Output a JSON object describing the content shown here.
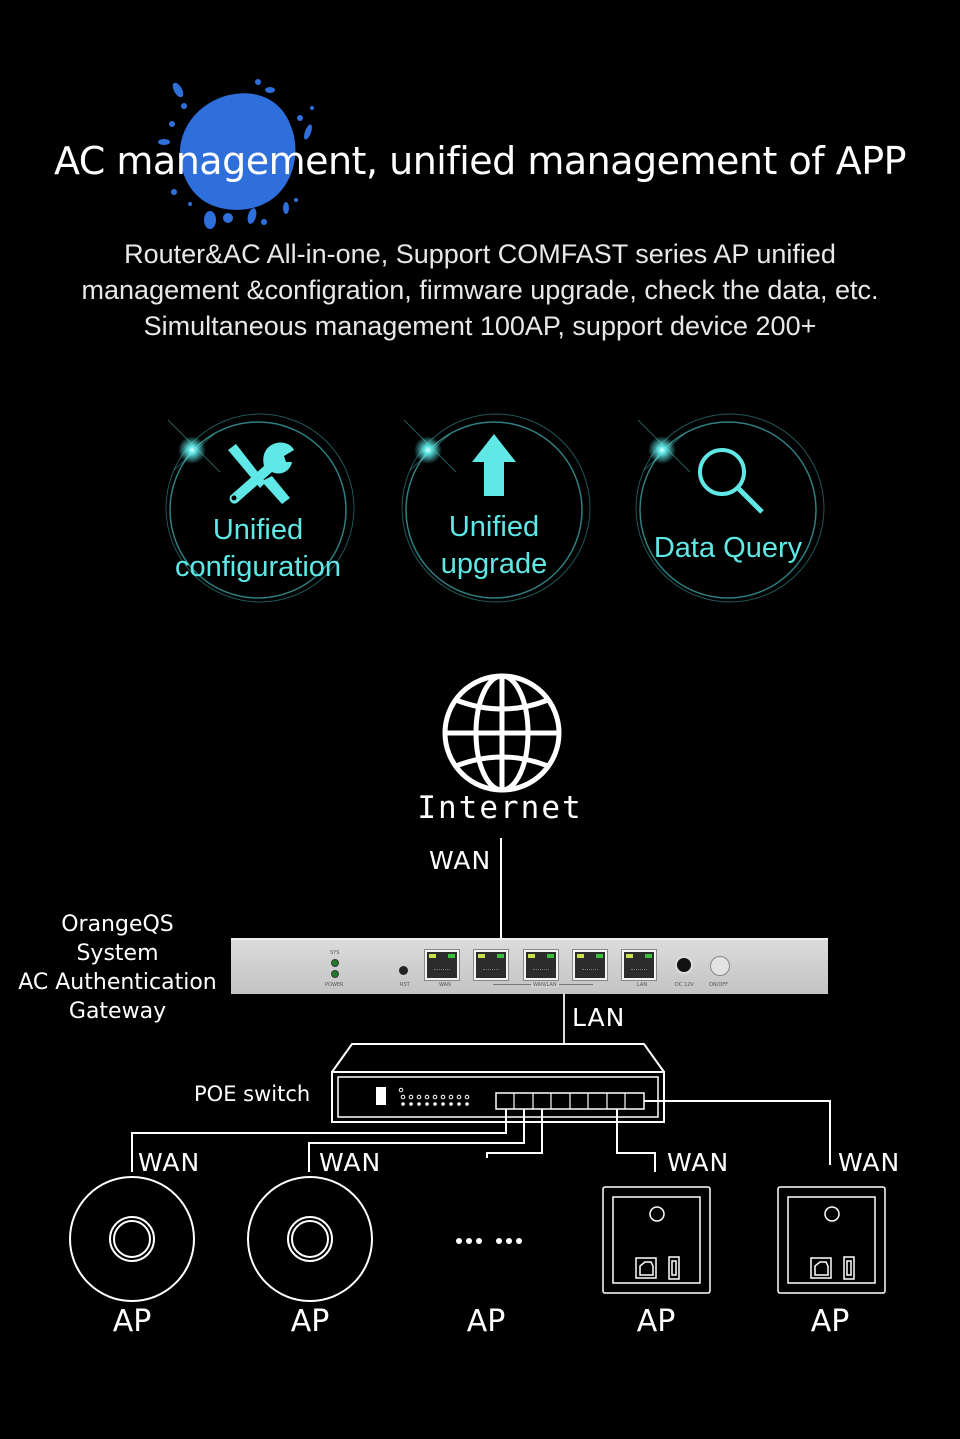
{
  "header": {
    "title": "AC management, unified management of APP",
    "subtitle_lines": [
      "Router&AC All-in-one, Support COMFAST series AP unified",
      "management &configration, firmware upgrade, check the data, etc.",
      "Simultaneous management 100AP, support device 200+"
    ],
    "splash_color": "#2f6fdb"
  },
  "features": [
    {
      "icon": "tools-icon",
      "label_lines": [
        "Unified",
        "configuration"
      ]
    },
    {
      "icon": "arrow-up-icon",
      "label_lines": [
        "Unified",
        "upgrade"
      ]
    },
    {
      "icon": "magnifier-icon",
      "label_lines": [
        "Data Query"
      ]
    }
  ],
  "accent_color": "#5fe8e6",
  "diagram": {
    "internet_label": "Internet",
    "internet_wan_label": "WAN",
    "gateway_label_lines": [
      "OrangeQS",
      "System",
      "AC Authentication",
      "Gateway"
    ],
    "router_panel": {
      "led_labels": [
        "SYS",
        "POWER"
      ],
      "rst_label": "RST",
      "port_labels": [
        "WAN",
        "WAN/LAN",
        "LAN"
      ],
      "dc_label": "DC 12V",
      "power_label": "ON/OFF"
    },
    "lan_label": "LAN",
    "poe_label": "POE switch",
    "ellipsis": "•••  •••",
    "aps": [
      {
        "type": "ceiling",
        "wan_label": "WAN",
        "label": "AP"
      },
      {
        "type": "ceiling",
        "wan_label": "WAN",
        "label": "AP"
      },
      {
        "type": "more",
        "wan_label": "",
        "label": "AP"
      },
      {
        "type": "wall-panel",
        "wan_label": "WAN",
        "label": "AP"
      },
      {
        "type": "wall-panel",
        "wan_label": "WAN",
        "label": "AP"
      }
    ]
  }
}
